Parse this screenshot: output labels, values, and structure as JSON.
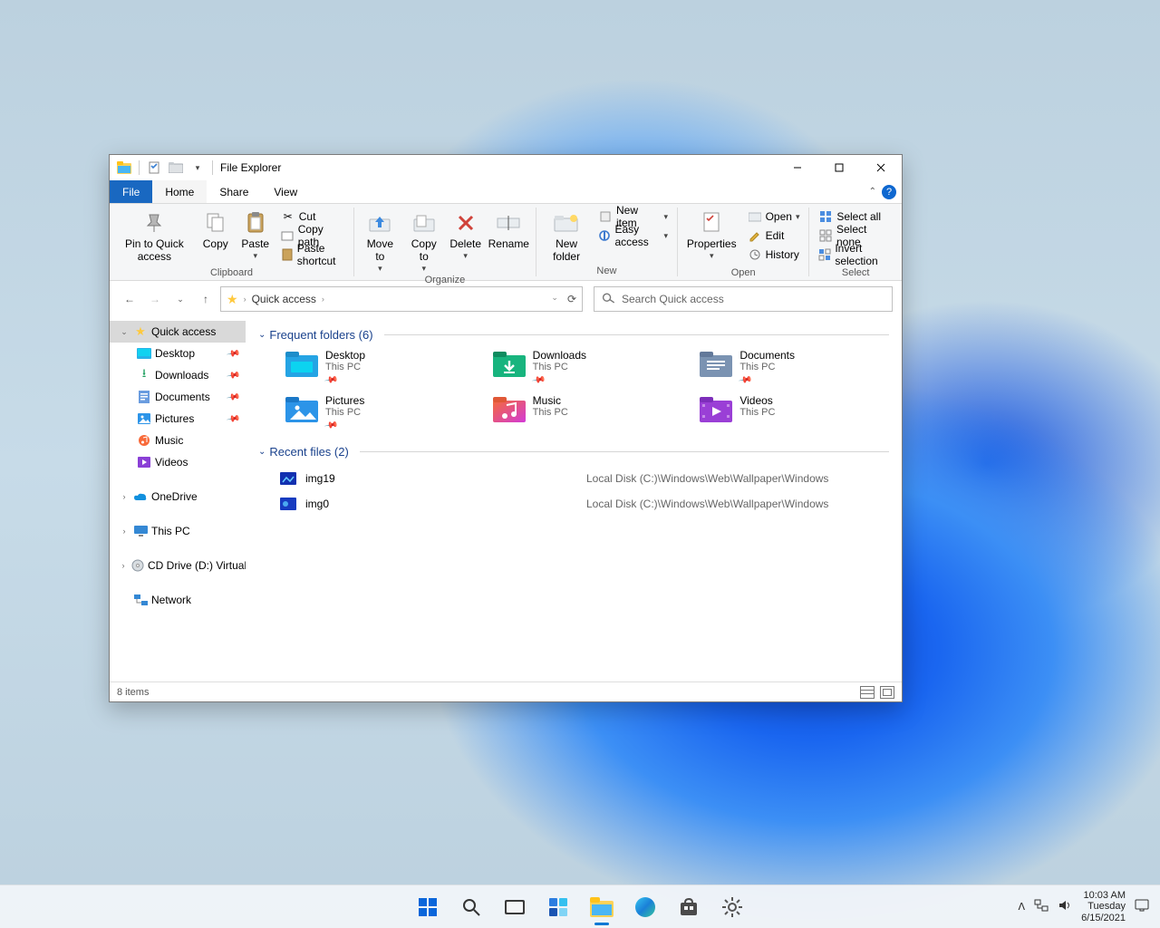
{
  "window": {
    "title": "File Explorer",
    "tabs": {
      "file": "File",
      "home": "Home",
      "share": "Share",
      "view": "View"
    }
  },
  "ribbon": {
    "pin": "Pin to Quick access",
    "copy": "Copy",
    "paste": "Paste",
    "cut": "Cut",
    "copy_path": "Copy path",
    "paste_shortcut": "Paste shortcut",
    "group_clipboard": "Clipboard",
    "move_to": "Move to",
    "copy_to": "Copy to",
    "delete": "Delete",
    "rename": "Rename",
    "group_organize": "Organize",
    "new_folder": "New folder",
    "new_item": "New item",
    "easy_access": "Easy access",
    "group_new": "New",
    "properties": "Properties",
    "open": "Open",
    "edit": "Edit",
    "history": "History",
    "group_open": "Open",
    "select_all": "Select all",
    "select_none": "Select none",
    "invert": "Invert selection",
    "group_select": "Select"
  },
  "address": {
    "location": "Quick access",
    "search_placeholder": "Search Quick access"
  },
  "sidebar": {
    "quick_access": "Quick access",
    "desktop": "Desktop",
    "downloads": "Downloads",
    "documents": "Documents",
    "pictures": "Pictures",
    "music": "Music",
    "videos": "Videos",
    "onedrive": "OneDrive",
    "thispc": "This PC",
    "cddrive": "CD Drive (D:) VirtualBox",
    "network": "Network"
  },
  "sections": {
    "frequent": "Frequent folders (6)",
    "recent": "Recent files (2)",
    "subtitle_thispc": "This PC"
  },
  "folders": [
    {
      "name": "Desktop"
    },
    {
      "name": "Downloads"
    },
    {
      "name": "Documents"
    },
    {
      "name": "Pictures"
    },
    {
      "name": "Music"
    },
    {
      "name": "Videos"
    }
  ],
  "files": [
    {
      "name": "img19",
      "path": "Local Disk (C:)\\Windows\\Web\\Wallpaper\\Windows"
    },
    {
      "name": "img0",
      "path": "Local Disk (C:)\\Windows\\Web\\Wallpaper\\Windows"
    }
  ],
  "statusbar": {
    "count": "8 items"
  },
  "taskbar": {
    "time": "10:03 AM",
    "day": "Tuesday",
    "date": "6/15/2021"
  }
}
